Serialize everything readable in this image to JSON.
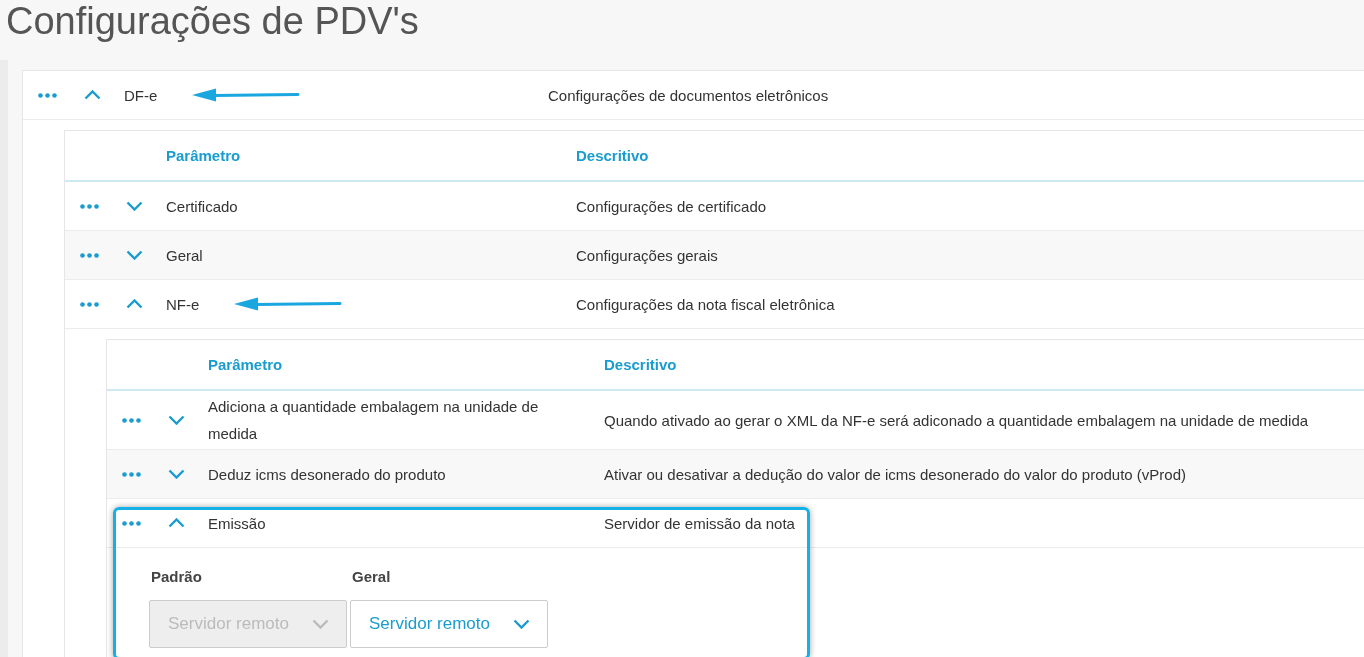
{
  "page": {
    "title": "Configurações de PDV's"
  },
  "parameters": {
    "rows": [
      {
        "name": "DF-e",
        "description": "Configurações de documentos eletrônicos",
        "expanded": true,
        "arrow": true,
        "highlighted": false,
        "table": {
          "columns": [
            "Parâmetro",
            "Descritivo"
          ],
          "rows": [
            {
              "name": "Certificado",
              "description": "Configurações de certificado",
              "expanded": false,
              "arrow": false,
              "highlighted": false
            },
            {
              "name": "Geral",
              "description": "Configurações gerais",
              "expanded": false,
              "arrow": false,
              "highlighted": false
            },
            {
              "name": "NF-e",
              "description": "Configurações da nota fiscal eletrônica",
              "expanded": true,
              "arrow": true,
              "highlighted": false,
              "table": {
                "columns": [
                  "Parâmetro",
                  "Descritivo"
                ],
                "rows": [
                  {
                    "name": "Adiciona a quantidade embalagem na unidade de medida",
                    "description": "Quando ativado ao gerar o XML da NF-e será adiconado a quantidade embalagem na unidade de medida",
                    "expanded": false,
                    "arrow": false,
                    "highlighted": false
                  },
                  {
                    "name": "Deduz icms desonerado do produto",
                    "description": "Ativar ou desativar a dedução do valor de icms desonerado do valor do produto (vProd)",
                    "expanded": false,
                    "arrow": false,
                    "highlighted": false
                  },
                  {
                    "name": "Emissão",
                    "description": "Servidor de emissão da nota",
                    "expanded": true,
                    "arrow": false,
                    "highlighted": true,
                    "editor": {
                      "fields": [
                        {
                          "label": "Padrão",
                          "value": "Servidor remoto",
                          "disabled": true
                        },
                        {
                          "label": "Geral",
                          "value": "Servidor remoto",
                          "disabled": false
                        }
                      ]
                    }
                  }
                ]
              }
            }
          ]
        }
      }
    ]
  }
}
